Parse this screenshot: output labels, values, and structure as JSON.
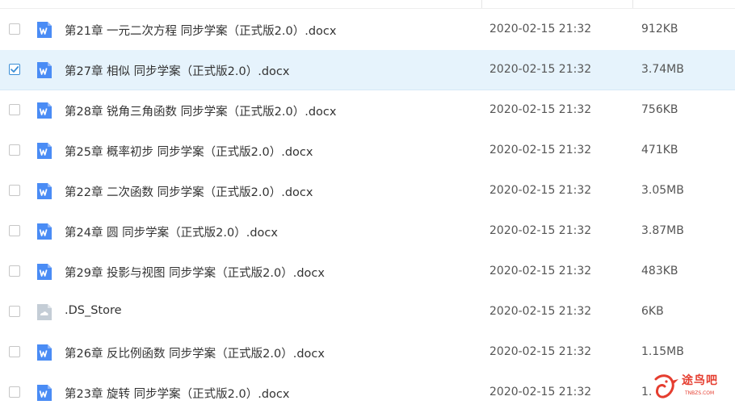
{
  "files": [
    {
      "name": "第21章 一元二次方程 同步学案（正式版2.0）.docx",
      "date": "2020-02-15 21:32",
      "size": "912KB",
      "type": "word",
      "checked": false
    },
    {
      "name": "第27章 相似 同步学案（正式版2.0）.docx",
      "date": "2020-02-15 21:32",
      "size": "3.74MB",
      "type": "word",
      "checked": true
    },
    {
      "name": "第28章 锐角三角函数 同步学案（正式版2.0）.docx",
      "date": "2020-02-15 21:32",
      "size": "756KB",
      "type": "word",
      "checked": false
    },
    {
      "name": "第25章 概率初步 同步学案（正式版2.0）.docx",
      "date": "2020-02-15 21:32",
      "size": "471KB",
      "type": "word",
      "checked": false
    },
    {
      "name": "第22章 二次函数 同步学案（正式版2.0）.docx",
      "date": "2020-02-15 21:32",
      "size": "3.05MB",
      "type": "word",
      "checked": false
    },
    {
      "name": "第24章 圆 同步学案（正式版2.0）.docx",
      "date": "2020-02-15 21:32",
      "size": "3.87MB",
      "type": "word",
      "checked": false
    },
    {
      "name": "第29章 投影与视图 同步学案（正式版2.0）.docx",
      "date": "2020-02-15 21:32",
      "size": "483KB",
      "type": "word",
      "checked": false
    },
    {
      "name": ".DS_Store",
      "date": "2020-02-15 21:32",
      "size": "6KB",
      "type": "generic",
      "checked": false
    },
    {
      "name": "第26章 反比例函数 同步学案（正式版2.0）.docx",
      "date": "2020-02-15 21:32",
      "size": "1.15MB",
      "type": "word",
      "checked": false
    },
    {
      "name": "第23章 旋转 同步学案（正式版2.0）.docx",
      "date": "2020-02-15 21:32",
      "size": "1.",
      "type": "word",
      "checked": false
    }
  ],
  "watermark": {
    "text": "途鸟吧",
    "sub": "TNBZS.COM"
  },
  "colors": {
    "word_icon": "#4a8cf5",
    "generic_icon": "#c4cdd6",
    "selected_row": "#e6f3fc",
    "check": "#3b8ed6",
    "watermark": "#e53d2f"
  }
}
